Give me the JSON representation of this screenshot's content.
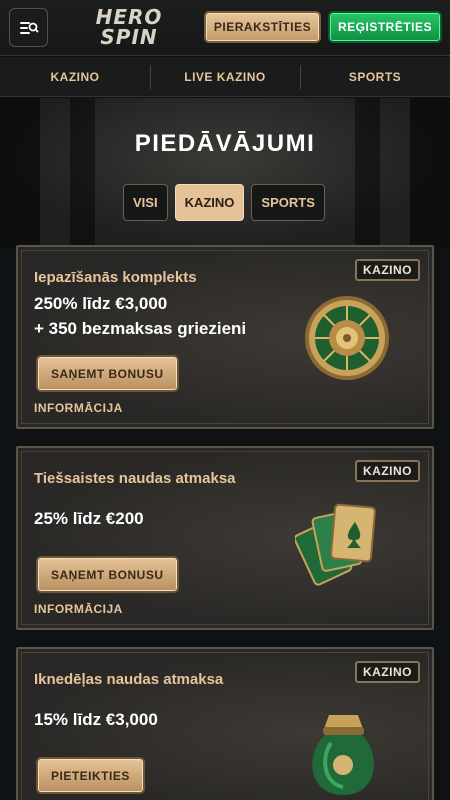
{
  "header": {
    "logo_line1": "HERO",
    "logo_line2": "SPIN",
    "login_label": "PIERAKSTĪTIES",
    "register_label": "REĢISTRĒTIES"
  },
  "nav": {
    "items": [
      {
        "label": "KAZINO"
      },
      {
        "label": "LIVE KAZINO"
      },
      {
        "label": "SPORTS"
      }
    ]
  },
  "page": {
    "title": "PIEDĀVĀJUMI",
    "filters": [
      {
        "label": "VISI",
        "active": false
      },
      {
        "label": "KAZINO",
        "active": true
      },
      {
        "label": "SPORTS",
        "active": false
      }
    ]
  },
  "offers": [
    {
      "badge": "KAZINO",
      "subtitle": "Iepazīšanās komplekts",
      "line1": "250% līdz €3,000",
      "line2": "+ 350 bezmaksas griezieni",
      "button": "SAŅEMT BONUSU",
      "link": "INFORMĀCIJA",
      "art": "roulette-wheel-icon"
    },
    {
      "badge": "KAZINO",
      "subtitle": "Tiešsaistes naudas atmaksa",
      "line1": "25% līdz €200",
      "button": "SAŅEMT BONUSU",
      "link": "INFORMĀCIJA",
      "art": "playing-cards-icon"
    },
    {
      "badge": "KAZINO",
      "subtitle": "Iknedēļas naudas atmaksa",
      "line1": "15% līdz €3,000",
      "button": "PIETEIKTIES",
      "art": "money-bag-icon"
    }
  ],
  "colors": {
    "accent_gold": "#e6c59b",
    "accent_green": "#1fb35a",
    "background": "#0f1214"
  }
}
